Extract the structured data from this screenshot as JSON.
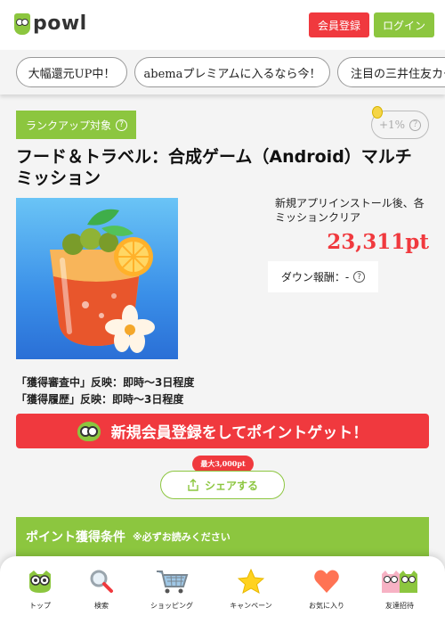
{
  "header": {
    "logo_text": "powl",
    "register_label": "会員登録",
    "login_label": "ログイン"
  },
  "tags": [
    "大幅還元UP中！",
    "abemaプレミアムに入るなら今！",
    "注目の三井住友カード"
  ],
  "offer": {
    "rank_badge": "ランクアップ対象",
    "bonus": "+1%",
    "title": "フード＆トラベル：合成ゲーム（Android）マルチミッション",
    "description": "新規アプリインストール後、各ミッションクリア",
    "points": "23,311pt",
    "down_reward": "ダウン報酬：-",
    "reflect_lines": [
      "「獲得審査中」反映：即時～3日程度",
      "「獲得履歴」反映：即時～3日程度"
    ],
    "cta_label": "新規会員登録をしてポイントゲット！",
    "share_max": "最大3,000pt",
    "share_label": "シェアする",
    "conditions_title": "ポイント獲得条件",
    "conditions_note": "※必ずお読みください"
  },
  "bottom_nav": [
    {
      "label": "トップ",
      "icon": "owl-icon"
    },
    {
      "label": "検索",
      "icon": "search-icon"
    },
    {
      "label": "ショッピング",
      "icon": "cart-icon"
    },
    {
      "label": "キャンペーン",
      "icon": "star-icon"
    },
    {
      "label": "お気に入り",
      "icon": "heart-icon"
    },
    {
      "label": "友達招待",
      "icon": "friends-icon"
    }
  ],
  "colors": {
    "brand_green": "#8cc63f",
    "accent_red": "#f0393e"
  }
}
